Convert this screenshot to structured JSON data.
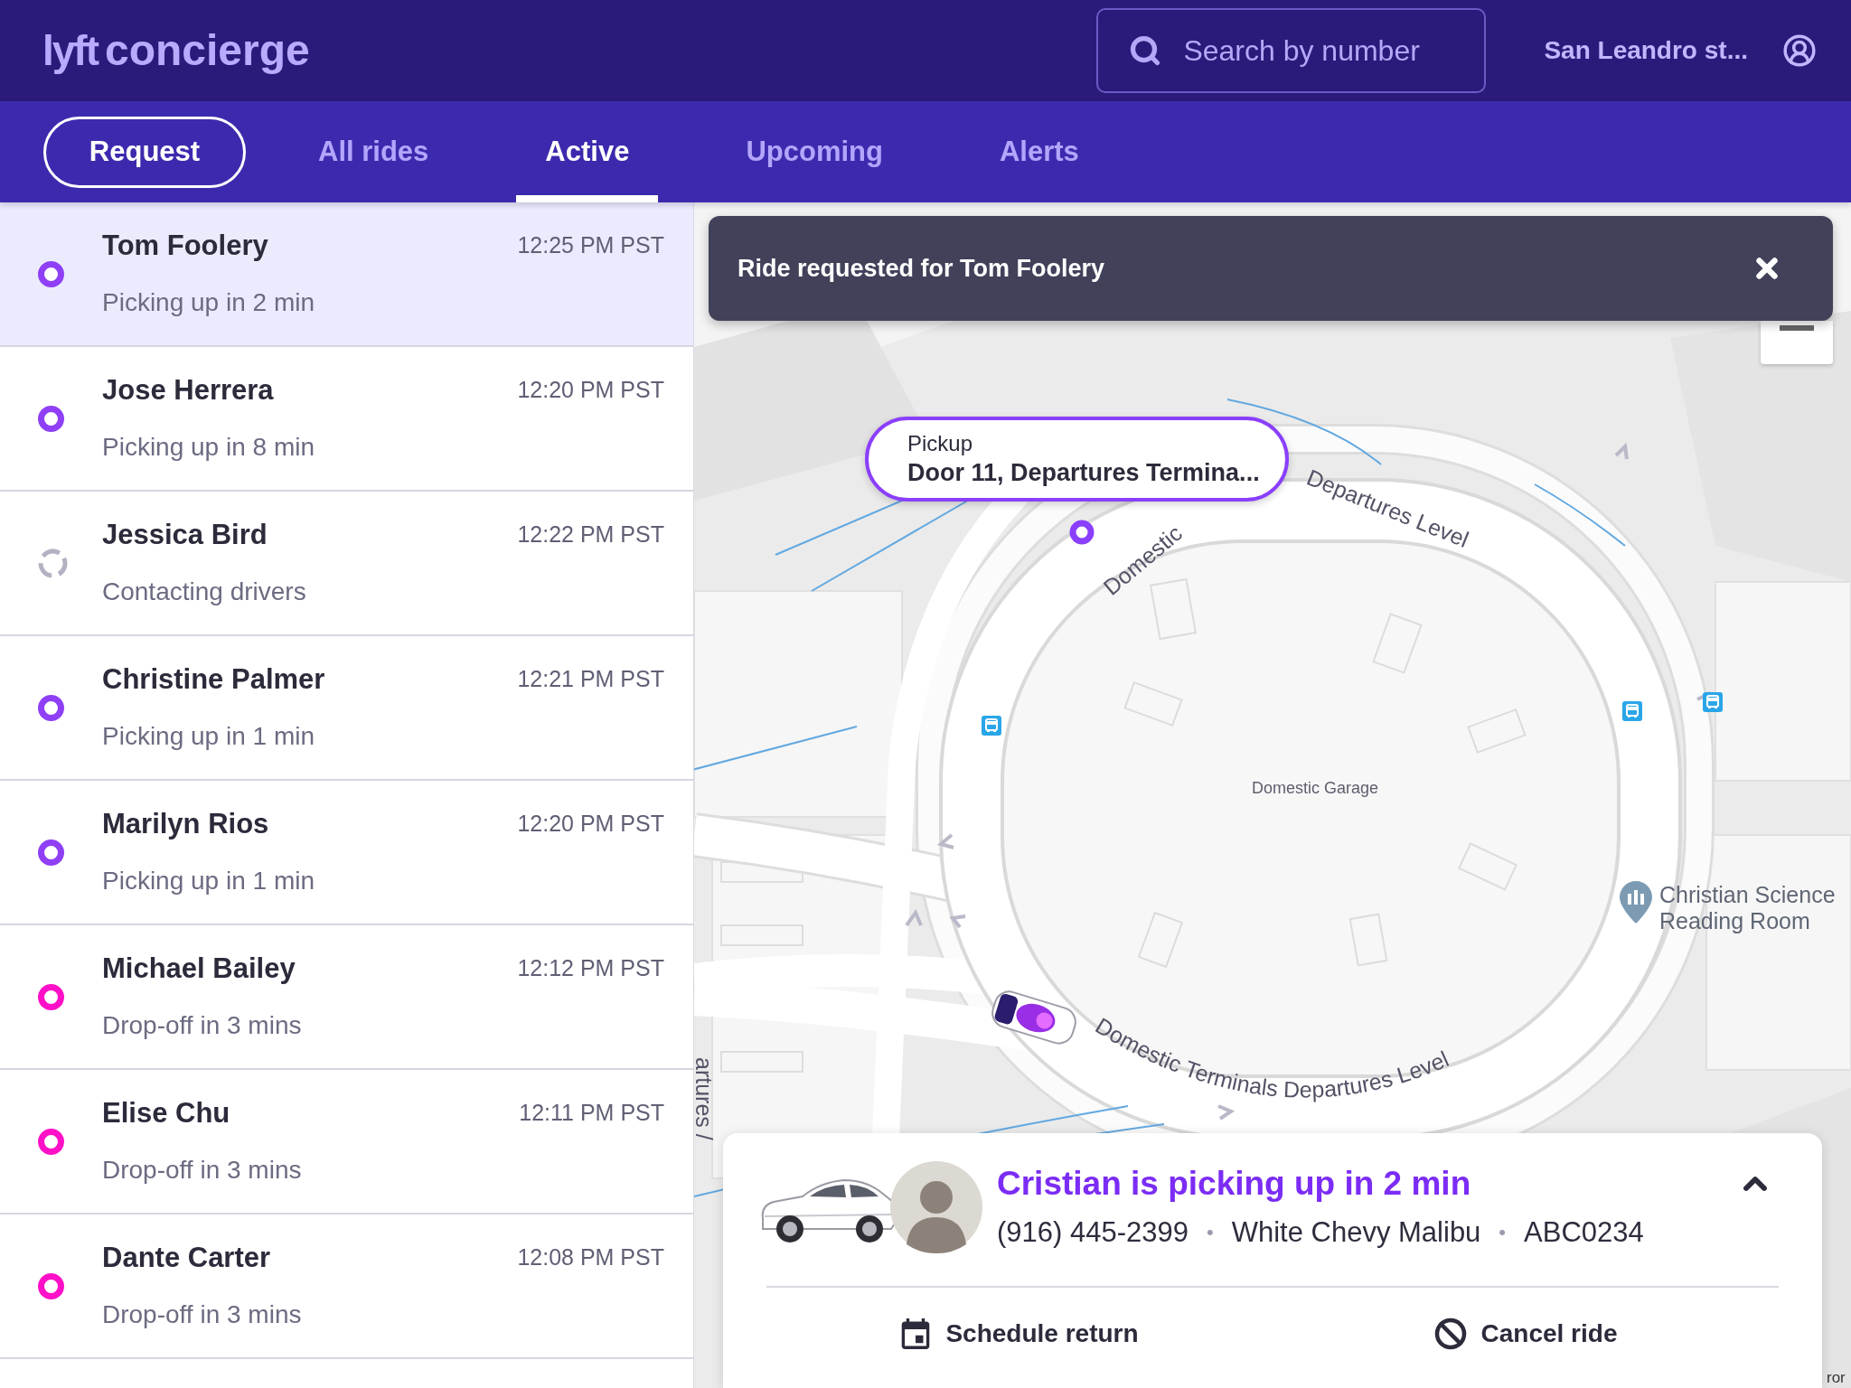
{
  "header": {
    "logo": {
      "mark": "lyft",
      "product": "concierge"
    },
    "search": {
      "placeholder": "Search by number"
    },
    "location": "San Leandro st..."
  },
  "nav": {
    "request_button": "Request",
    "tabs": [
      {
        "label": "All rides",
        "selected": false
      },
      {
        "label": "Active",
        "selected": true
      },
      {
        "label": "Upcoming",
        "selected": false
      },
      {
        "label": "Alerts",
        "selected": false
      }
    ]
  },
  "rides": [
    {
      "name": "Tom Foolery",
      "time": "12:25 PM PST",
      "status": "Picking up in 2 min",
      "kind": "ring",
      "color": "#8f3ff5",
      "selected": true
    },
    {
      "name": "Jose Herrera",
      "time": "12:20 PM PST",
      "status": "Picking up in 8 min",
      "kind": "ring",
      "color": "#8f3ff5",
      "selected": false
    },
    {
      "name": "Jessica Bird",
      "time": "12:22 PM PST",
      "status": "Contacting drivers",
      "kind": "spinner",
      "color": "#b2b2c2",
      "selected": false
    },
    {
      "name": "Christine Palmer",
      "time": "12:21 PM PST",
      "status": "Picking up in 1 min",
      "kind": "ring",
      "color": "#8f3ff5",
      "selected": false
    },
    {
      "name": "Marilyn Rios",
      "time": "12:20 PM PST",
      "status": "Picking up in 1 min",
      "kind": "ring",
      "color": "#8f3ff5",
      "selected": false
    },
    {
      "name": "Michael Bailey",
      "time": "12:12 PM PST",
      "status": "Drop-off in 3 mins",
      "kind": "ring",
      "color": "#ff10c8",
      "selected": false
    },
    {
      "name": "Elise Chu",
      "time": "12:11 PM PST",
      "status": "Drop-off in 3 mins",
      "kind": "ring",
      "color": "#ff10c8",
      "selected": false
    },
    {
      "name": "Dante Carter",
      "time": "12:08 PM PST",
      "status": "Drop-off in 3 mins",
      "kind": "ring",
      "color": "#ff10c8",
      "selected": false
    }
  ],
  "map": {
    "toast": {
      "message": "Ride requested for Tom Foolery"
    },
    "pickup": {
      "label": "Pickup",
      "address": "Door 11, Departures Termina..."
    },
    "labels": [
      {
        "text": "Domestic",
        "kind": "road"
      },
      {
        "text": "Departures Level",
        "kind": "road"
      },
      {
        "text": "Domestic Garage",
        "kind": "area"
      },
      {
        "text": "Christian Science Reading Room",
        "kind": "poi"
      },
      {
        "text": "Domestic Terminals Departures Level",
        "kind": "curved_road"
      },
      {
        "text": "artures /",
        "kind": "road"
      },
      {
        "text": "ror",
        "kind": "attribution"
      }
    ]
  },
  "driver_card": {
    "title": "Cristian is picking up in 2 min",
    "details": [
      {
        "text": "(916) 445-2399",
        "kind": "value"
      },
      {
        "text": "•",
        "kind": "separator"
      },
      {
        "text": "White Chevy Malibu",
        "kind": "value"
      },
      {
        "text": "•",
        "kind": "separator"
      },
      {
        "text": "ABC0234",
        "kind": "value"
      }
    ],
    "expanded": true,
    "actions": [
      {
        "label": "Schedule return",
        "kind": "schedule"
      },
      {
        "label": "Cancel ride",
        "kind": "cancel"
      }
    ]
  }
}
